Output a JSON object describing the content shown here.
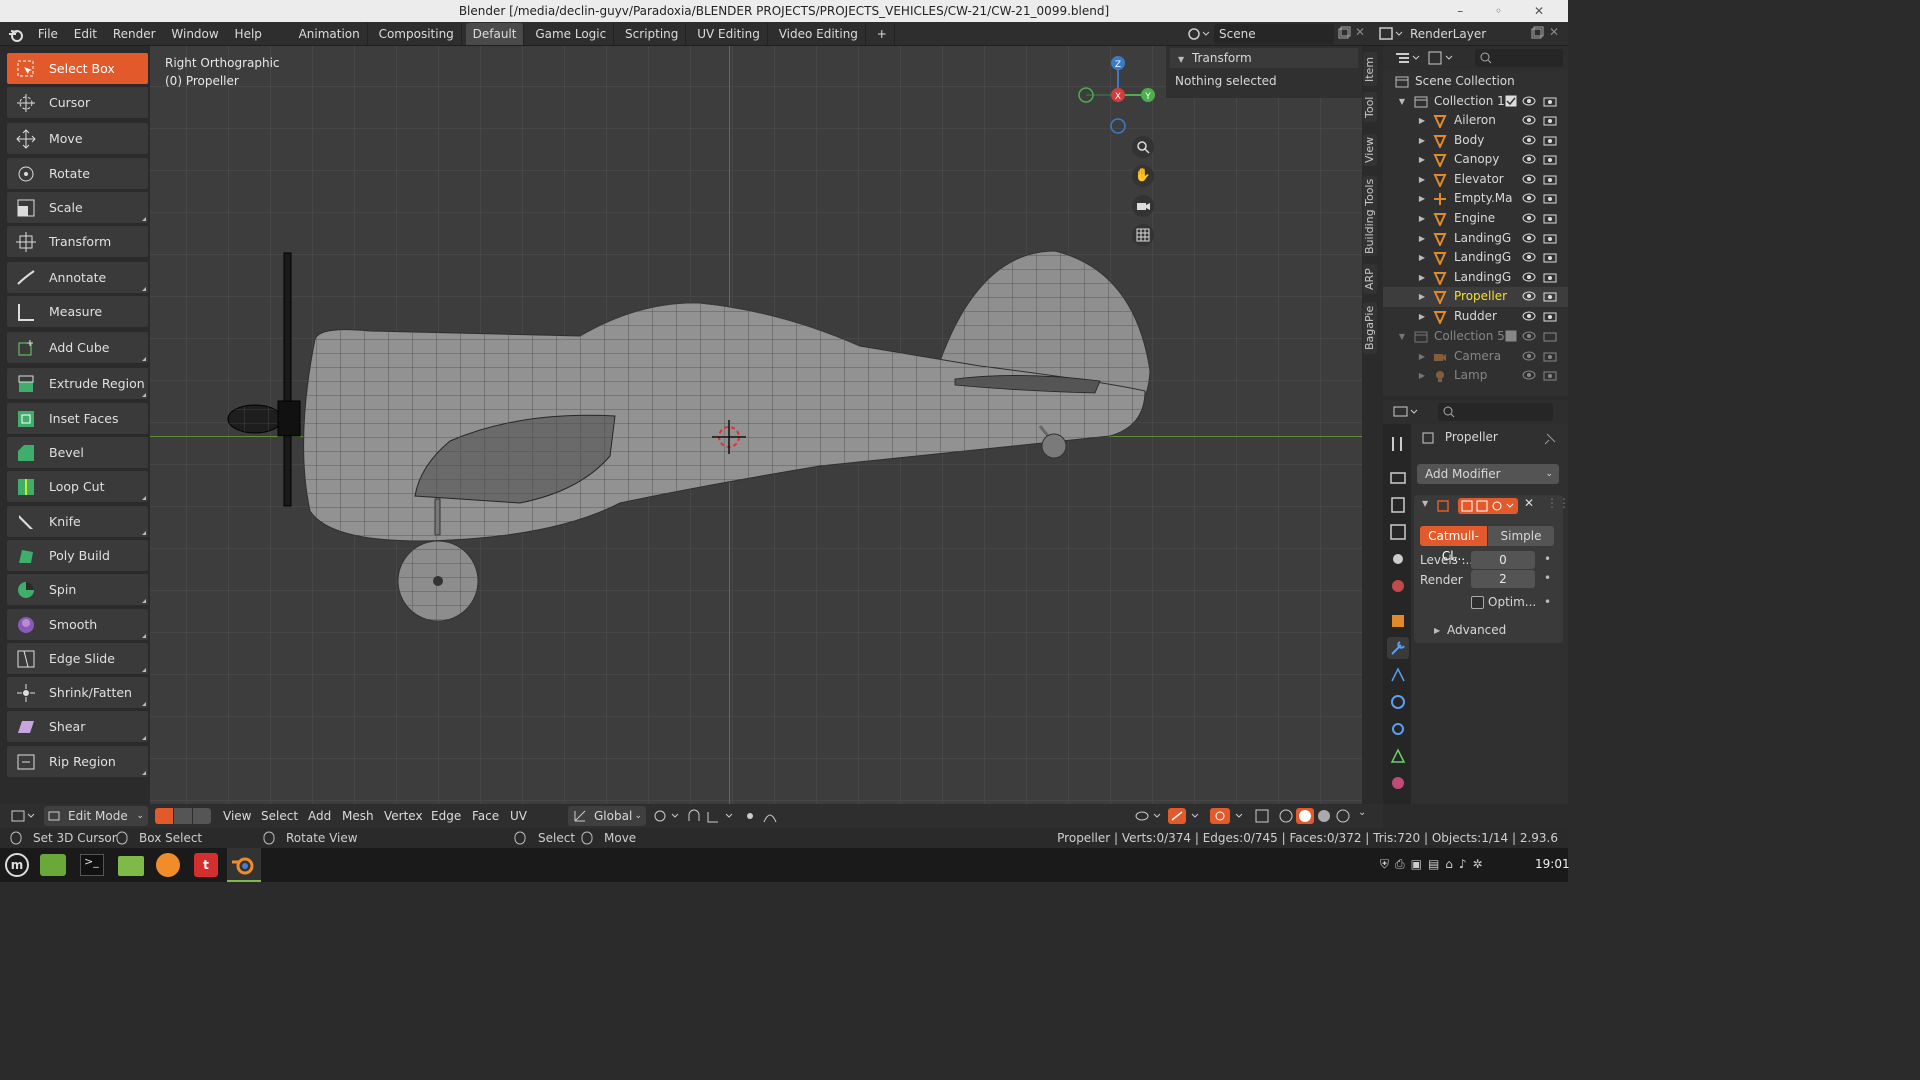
{
  "window": {
    "title": "Blender [/media/declin-guyv/Paradoxia/BLENDER PROJECTS/PROJECTS_VEHICLES/CW-21/CW-21_0099.blend]"
  },
  "menu": {
    "items": [
      "File",
      "Edit",
      "Render",
      "Window",
      "Help"
    ]
  },
  "workspaces": {
    "tabs": [
      "Animation",
      "Compositing",
      "Default",
      "Game Logic",
      "Scripting",
      "UV Editing",
      "Video Editing"
    ],
    "active": "Default",
    "add": "+"
  },
  "scene": {
    "name": "Scene",
    "render_layer": "RenderLayer"
  },
  "toolbar": {
    "tools": [
      "Select Box",
      "Cursor",
      "Move",
      "Rotate",
      "Scale",
      "Transform",
      "Annotate",
      "Measure",
      "Add Cube",
      "Extrude Region",
      "Inset Faces",
      "Bevel",
      "Loop Cut",
      "Knife",
      "Poly Build",
      "Spin",
      "Smooth",
      "Edge Slide",
      "Shrink/Fatten",
      "Shear",
      "Rip Region"
    ],
    "active": "Select Box"
  },
  "viewport": {
    "view_name": "Right Orthographic",
    "object_label": "(0) Propeller",
    "accent": "#e25a2b"
  },
  "n_panel": {
    "section": "Transform",
    "message": "Nothing selected"
  },
  "side_tabs": [
    "Item",
    "Tool",
    "View",
    "Building Tools",
    "ARP",
    "BagaPie"
  ],
  "outliner": {
    "root": "Scene Collection",
    "collection1": "Collection 1",
    "objects": [
      "Aileron",
      "Body",
      "Canopy",
      "Elevator",
      "Empty.Ma",
      "Engine",
      "LandingG",
      "LandingG",
      "LandingG",
      "Propeller",
      "Rudder"
    ],
    "selected": "Propeller",
    "collection5": "Collection 5",
    "collection5_objects": [
      "Camera",
      "Lamp"
    ]
  },
  "properties": {
    "object_name": "Propeller",
    "add_modifier": "Add Modifier",
    "subdiv": {
      "mode_a": "Catmull-Cl...",
      "mode_b": "Simple",
      "levels_label": "Levels ...",
      "levels_value": "0",
      "render_label": "Render",
      "render_value": "2",
      "optimal_label": "Optim...",
      "advanced": "Advanced"
    }
  },
  "header": {
    "mode": "Edit Mode",
    "menus": [
      "View",
      "Select",
      "Add",
      "Mesh",
      "Vertex",
      "Edge",
      "Face",
      "UV"
    ],
    "orientation": "Global"
  },
  "status": {
    "left": [
      "Set 3D Cursor",
      "Box Select",
      "Rotate View",
      "Select",
      "Move"
    ],
    "stats": "Propeller | Verts:0/374 | Edges:0/745 | Faces:0/372 | Tris:720 | Objects:1/14 | 2.93.6"
  },
  "taskbar": {
    "clock": "19:01"
  },
  "gizmo": {
    "x": "X",
    "y": "Y",
    "z": "Z"
  }
}
